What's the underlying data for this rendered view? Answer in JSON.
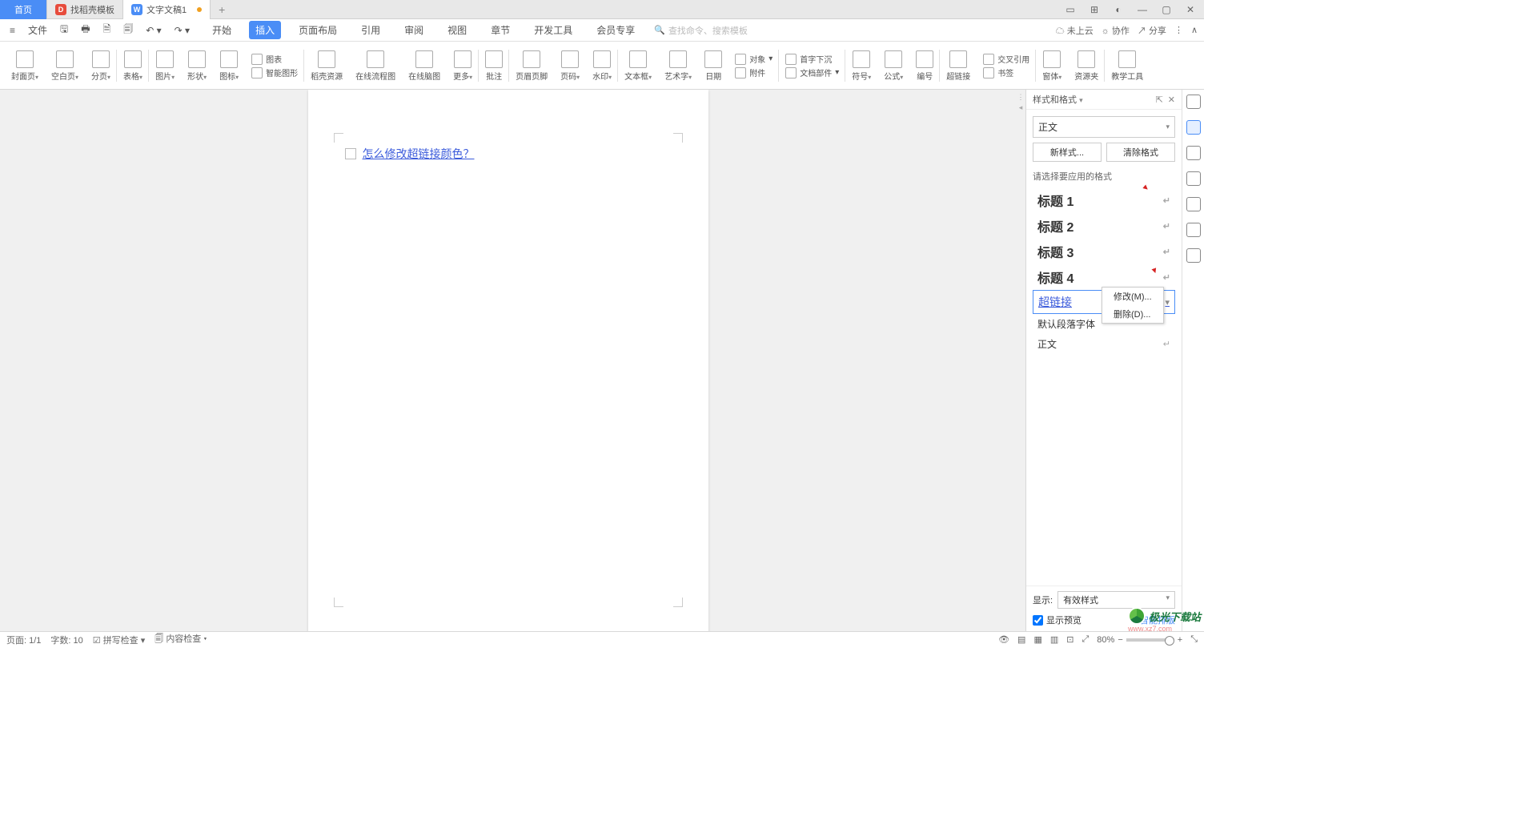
{
  "tabs": {
    "home": "首页",
    "tab1": "找稻壳模板",
    "tab2": "文字文稿1"
  },
  "menu": {
    "file": "文件",
    "items": [
      "开始",
      "插入",
      "页面布局",
      "引用",
      "审阅",
      "视图",
      "章节",
      "开发工具",
      "会员专享"
    ],
    "active_index": 1,
    "search_placeholder": "查找命令、搜索模板",
    "cloud": "未上云",
    "coop": "协作",
    "share": "分享"
  },
  "ribbon": {
    "cover": "封面页",
    "blank": "空白页",
    "pagebreak": "分页",
    "table": "表格",
    "picture": "图片",
    "shape": "形状",
    "icon": "图标",
    "chart": "图表",
    "smartart": "智能图形",
    "docres": "稻壳资源",
    "flowchart": "在线流程图",
    "mindmap": "在线脑图",
    "more": "更多",
    "comment": "批注",
    "headerfooter": "页眉页脚",
    "pagenum": "页码",
    "watermark": "水印",
    "textbox": "文本框",
    "wordart": "艺术字",
    "date": "日期",
    "object": "对象",
    "attach": "附件",
    "firstdrop": "首字下沉",
    "docpart": "文档部件",
    "symbol": "符号",
    "formula": "公式",
    "number": "编号",
    "hyperlink": "超链接",
    "crossref": "交叉引用",
    "bookmark": "书签",
    "window": "窗体",
    "resource": "资源夹",
    "teaching": "教学工具"
  },
  "document": {
    "text": "怎么修改超链接颜色？"
  },
  "panel": {
    "title": "样式和格式",
    "current": "正文",
    "new_style": "新样式...",
    "clear": "清除格式",
    "choose": "请选择要应用的格式",
    "styles": [
      "标题 1",
      "标题 2",
      "标题 3",
      "标题 4"
    ],
    "selected": "超链接",
    "default_font": "默认段落字体",
    "body": "正文",
    "ctx_modify": "修改(M)...",
    "ctx_delete": "删除(D)...",
    "show": "显示:",
    "show_value": "有效样式",
    "preview": "显示预览",
    "smart": "智能排版"
  },
  "status": {
    "page": "页面: 1/1",
    "words": "字数: 10",
    "spell": "拼写检查",
    "content": "内容检查",
    "zoom": "80%"
  },
  "watermark": {
    "main": "极光下载站",
    "sub": "www.xz7.com"
  }
}
